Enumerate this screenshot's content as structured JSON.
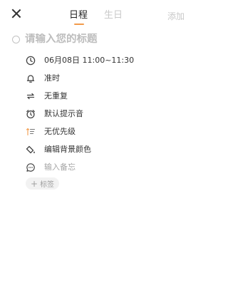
{
  "header": {
    "tabs": [
      {
        "label": "日程",
        "active": true
      },
      {
        "label": "生日",
        "active": false
      }
    ],
    "add_label": "添加",
    "accent_color": "#f29a4a"
  },
  "title": {
    "placeholder": "请输入您的标题"
  },
  "details": [
    {
      "icon": "clock-icon",
      "label": "06月08日 11:00~11:30"
    },
    {
      "icon": "bell-icon",
      "label": "准时"
    },
    {
      "icon": "repeat-icon",
      "label": "无重复"
    },
    {
      "icon": "alarm-icon",
      "label": "默认提示音"
    },
    {
      "icon": "priority-icon",
      "label": "无优先级"
    },
    {
      "icon": "paint-bucket-icon",
      "label": "编辑背景颜色"
    },
    {
      "icon": "comment-icon",
      "label": "输入备忘",
      "placeholder": true
    }
  ],
  "tag_button": {
    "label": "标签"
  }
}
